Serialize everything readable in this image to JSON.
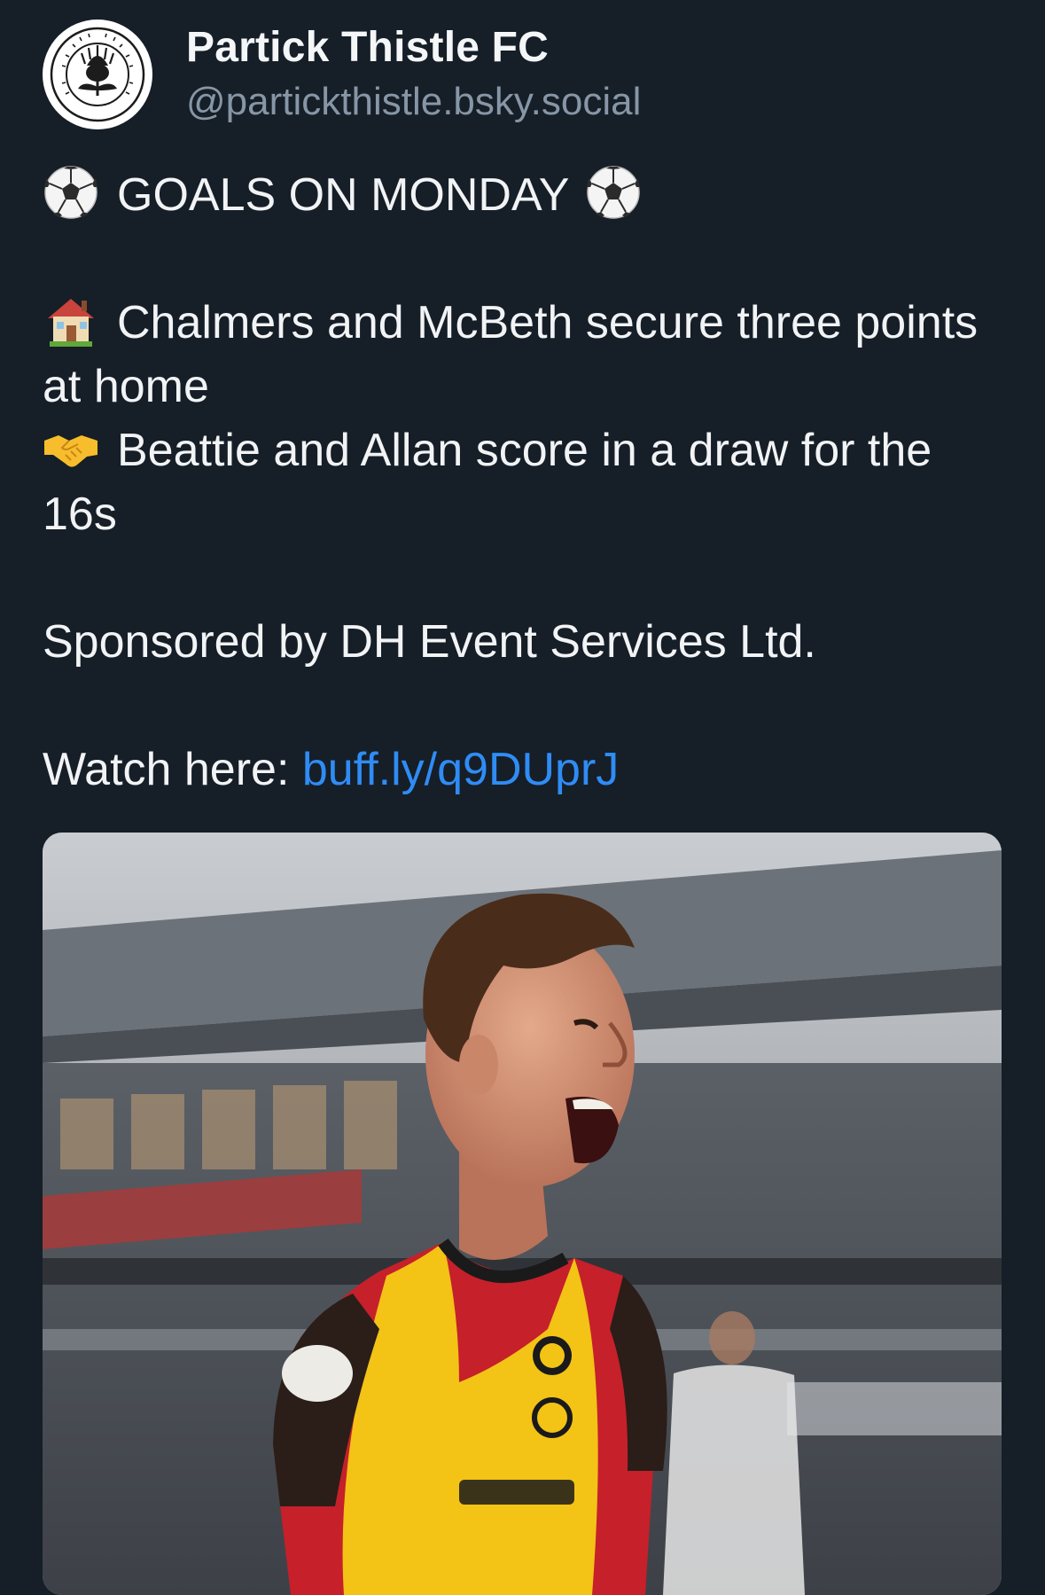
{
  "author": {
    "display_name": "Partick Thistle FC",
    "handle": "@partickthistle.bsky.social",
    "avatar_icon": "partick-thistle-crest-icon"
  },
  "post": {
    "headline": "GOALS ON MONDAY",
    "headline_icon": "soccer-ball-icon",
    "item1_icon": "house-icon",
    "item1_text": "Chalmers and McBeth secure three points at home",
    "item2_icon": "handshake-icon",
    "item2_text": "Beattie and Allan score in a draw for the 16s",
    "sponsor_text": "Sponsored by DH Event Services Ltd.",
    "watch_label": "Watch here: ",
    "watch_link": "buff.ly/q9DUprJ"
  },
  "media": {
    "kind": "photo",
    "subject": "player-celebrating-photo"
  },
  "colors": {
    "background": "#161e27",
    "text": "#f1f3f5",
    "handle": "#8796a6",
    "link": "#2f8cf5",
    "kit_red": "#c6202b",
    "kit_yellow": "#f3c316"
  }
}
